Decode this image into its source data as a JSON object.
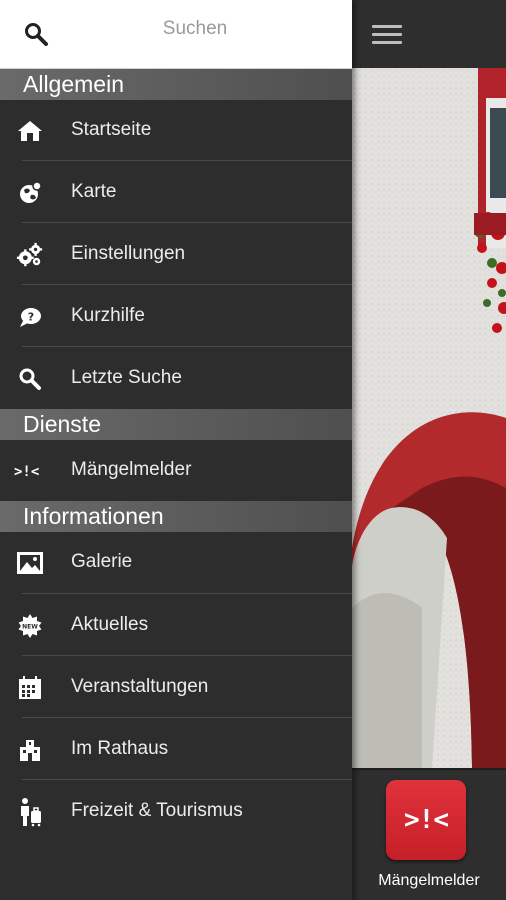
{
  "search": {
    "placeholder": "Suchen",
    "icon": "search-icon"
  },
  "sections": [
    {
      "title": "Allgemein",
      "items": [
        {
          "label": "Startseite",
          "icon": "home-icon"
        },
        {
          "label": "Karte",
          "icon": "globe-icon"
        },
        {
          "label": "Einstellungen",
          "icon": "gears-icon"
        },
        {
          "label": "Kurzhilfe",
          "icon": "help-bubble-icon"
        },
        {
          "label": "Letzte Suche",
          "icon": "search-icon"
        }
      ]
    },
    {
      "title": "Dienste",
      "items": [
        {
          "label": "Mängelmelder",
          "icon": "maengelmelder-icon"
        }
      ]
    },
    {
      "title": "Informationen",
      "items": [
        {
          "label": "Galerie",
          "icon": "gallery-icon"
        },
        {
          "label": "Aktuelles",
          "icon": "news-badge-icon"
        },
        {
          "label": "Veranstaltungen",
          "icon": "calendar-icon"
        },
        {
          "label": "Im Rathaus",
          "icon": "town-hall-icon"
        },
        {
          "label": "Freizeit & Tourismus",
          "icon": "tourism-icon"
        }
      ]
    }
  ],
  "header": {
    "menu_icon": "hamburger-menu-icon"
  },
  "tile": {
    "label": "Mängelmelder",
    "icon_text": ">!<",
    "icon_color": "#d42a33"
  },
  "colors": {
    "drawer_bg": "#2d2d2d",
    "section_bg": "#5e5e5e",
    "text": "#ececec",
    "accent_red": "#d42a33"
  }
}
